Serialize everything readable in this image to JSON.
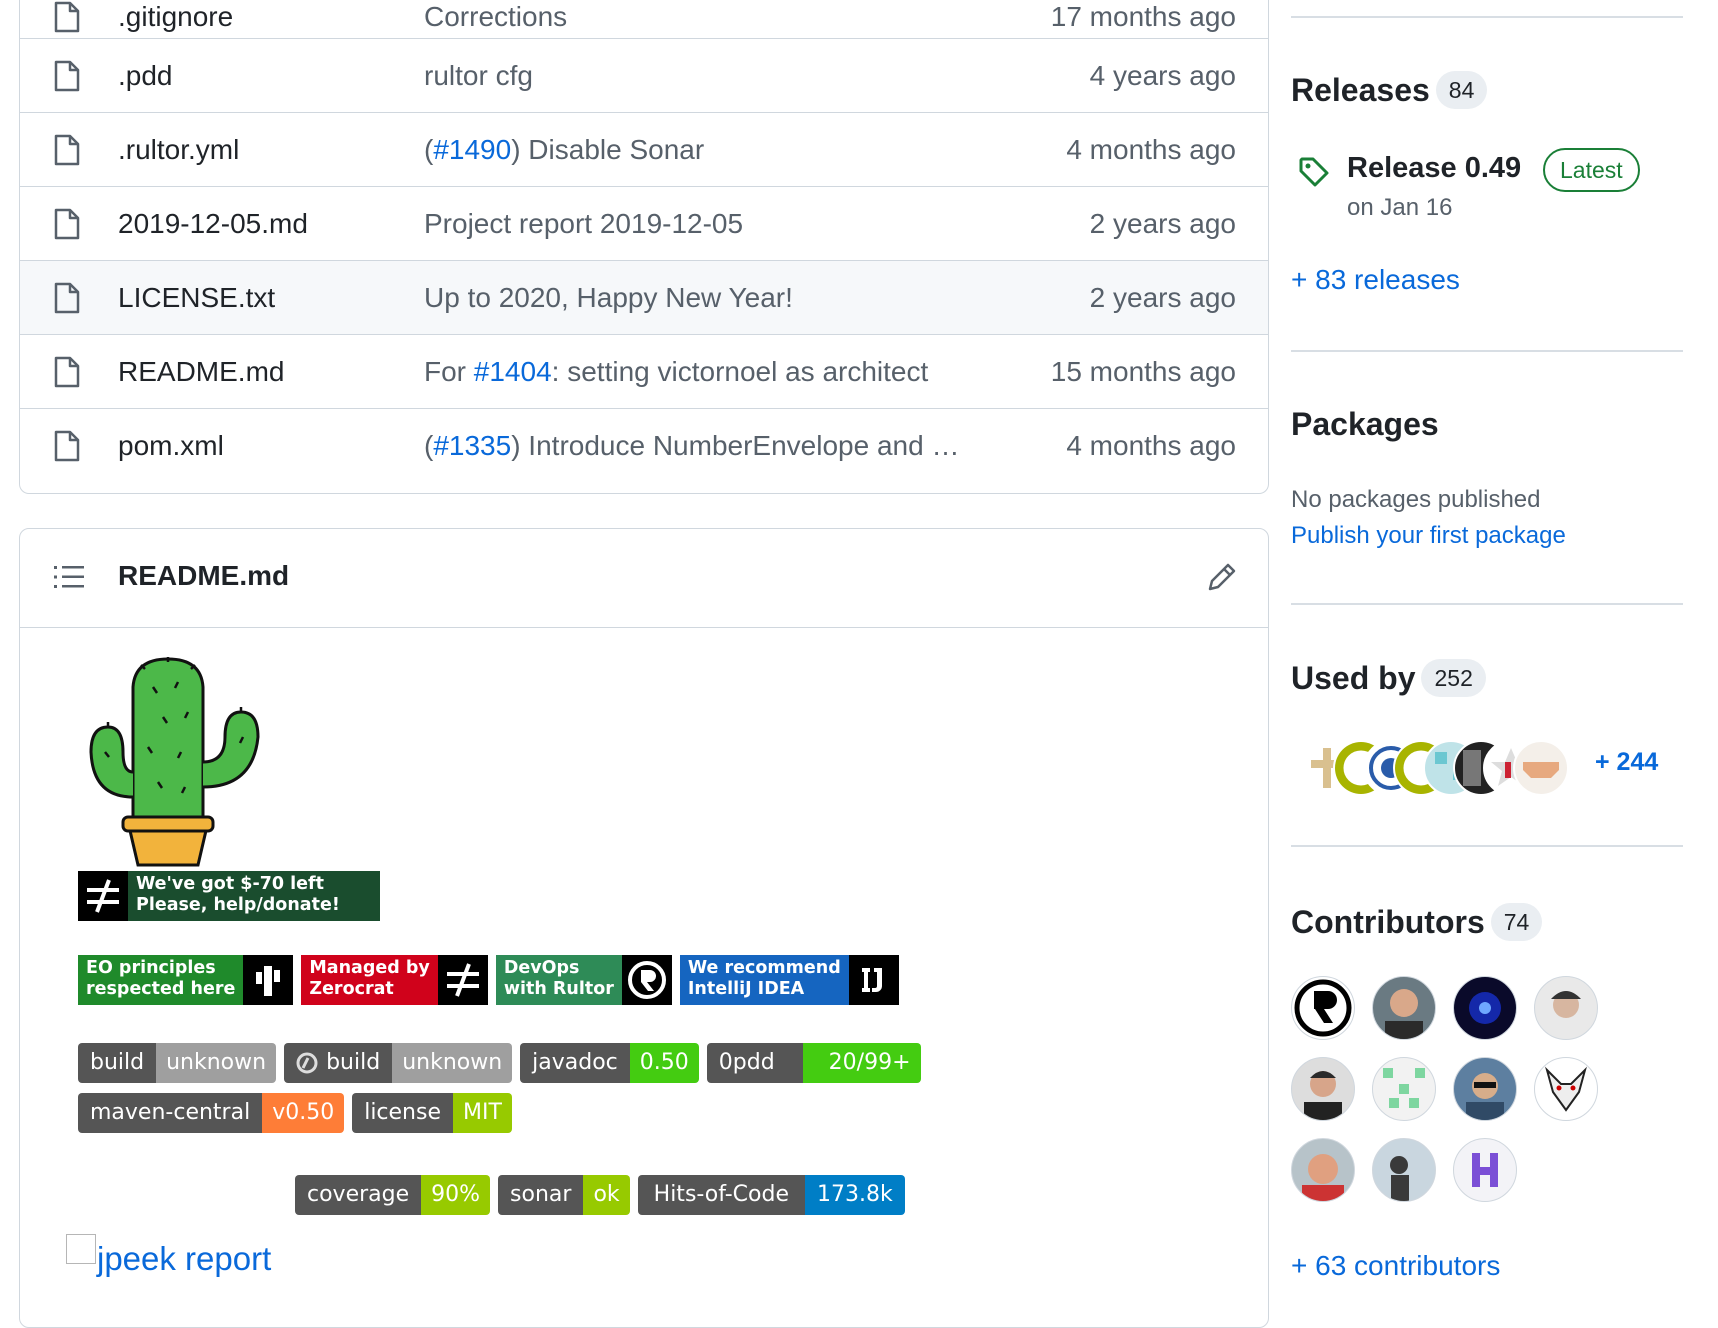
{
  "files": [
    {
      "name": ".gitignore",
      "message": "Corrections",
      "age": "17 months ago"
    },
    {
      "name": ".pdd",
      "message": "rultor cfg",
      "age": "4 years ago"
    },
    {
      "name": ".rultor.yml",
      "message_pre": "(",
      "message_link": "#1490",
      "message_post": ") Disable Sonar",
      "age": "4 months ago"
    },
    {
      "name": "2019-12-05.md",
      "message": "Project report 2019-12-05",
      "age": "2 years ago"
    },
    {
      "name": "LICENSE.txt",
      "message": "Up to 2020, Happy New Year!",
      "age": "2 years ago"
    },
    {
      "name": "README.md",
      "message_pre": "For ",
      "message_link": "#1404",
      "message_post": ": setting victornoel as architect",
      "age": "15 months ago"
    },
    {
      "name": "pom.xml",
      "message_pre": "(",
      "message_link": "#1335",
      "message_post": ") Introduce NumberEnvelope and …",
      "age": "4 months ago"
    }
  ],
  "readme": {
    "title": "README.md",
    "donate_badge": "We've got $-70 left\nPlease, help/donate!",
    "big_badges": [
      {
        "text": "EO principles\nrespected here",
        "color": "#1f8a2b"
      },
      {
        "text": "Managed by\nZerocrat",
        "color": "#d0021b"
      },
      {
        "text": "DevOps\nwith Rultor",
        "color": "#2e8b57"
      },
      {
        "text": "We recommend\nIntelliJ IDEA",
        "color": "#1565c0"
      }
    ],
    "shields_row1": [
      {
        "label": "build",
        "value": "unknown",
        "color": "#9f9f9f"
      },
      {
        "label": "build",
        "value": "unknown",
        "color": "#9f9f9f"
      },
      {
        "label": "javadoc",
        "value": "0.50",
        "color": "#4c1"
      },
      {
        "label": "0pdd",
        "value": "20/99+",
        "color": "#44cc11"
      }
    ],
    "shields_row2": [
      {
        "label": "maven-central",
        "value": "v0.50",
        "color": "#fe7d37"
      },
      {
        "label": "license",
        "value": "MIT",
        "color": "#97ca00"
      }
    ],
    "jpeek": "jpeek report",
    "shields_row3": [
      {
        "label": "coverage",
        "value": "90%",
        "color": "#97ca00"
      },
      {
        "label": "sonar",
        "value": "ok",
        "color": "#97ca00"
      },
      {
        "label": "Hits-of-Code",
        "value": "173.8k",
        "color": "#007ec6"
      }
    ]
  },
  "sidebar": {
    "releases": {
      "heading": "Releases",
      "count": "84",
      "latest_name": "Release 0.49",
      "latest_badge": "Latest",
      "latest_date": "on Jan 16",
      "more": "+ 83 releases"
    },
    "packages": {
      "heading": "Packages",
      "empty": "No packages published",
      "link": "Publish your first package"
    },
    "used_by": {
      "heading": "Used by",
      "count": "252",
      "more": "+ 244"
    },
    "contributors": {
      "heading": "Contributors",
      "count": "74",
      "more": "+ 63 contributors"
    }
  },
  "colors": {
    "link": "#0969da",
    "latest_green": "#1a7f37",
    "border": "#d0d7de"
  }
}
